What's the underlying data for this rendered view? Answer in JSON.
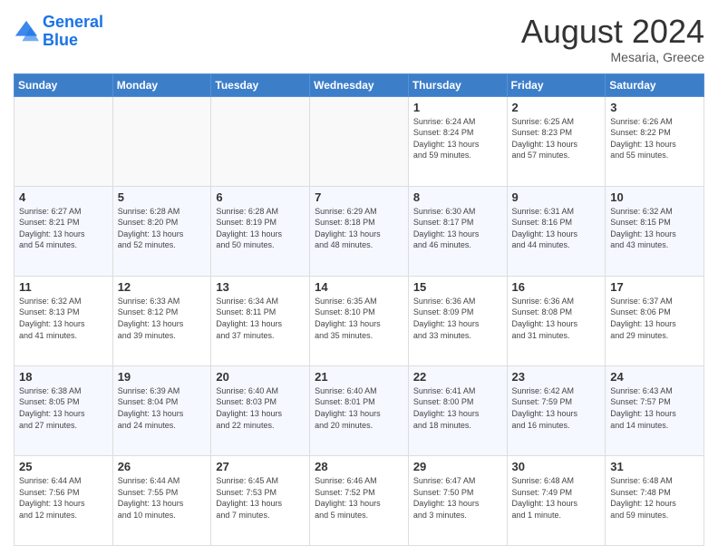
{
  "header": {
    "logo_line1": "General",
    "logo_line2": "Blue",
    "month": "August 2024",
    "location": "Mesaria, Greece"
  },
  "weekdays": [
    "Sunday",
    "Monday",
    "Tuesday",
    "Wednesday",
    "Thursday",
    "Friday",
    "Saturday"
  ],
  "weeks": [
    [
      {
        "day": "",
        "info": ""
      },
      {
        "day": "",
        "info": ""
      },
      {
        "day": "",
        "info": ""
      },
      {
        "day": "",
        "info": ""
      },
      {
        "day": "1",
        "info": "Sunrise: 6:24 AM\nSunset: 8:24 PM\nDaylight: 13 hours\nand 59 minutes."
      },
      {
        "day": "2",
        "info": "Sunrise: 6:25 AM\nSunset: 8:23 PM\nDaylight: 13 hours\nand 57 minutes."
      },
      {
        "day": "3",
        "info": "Sunrise: 6:26 AM\nSunset: 8:22 PM\nDaylight: 13 hours\nand 55 minutes."
      }
    ],
    [
      {
        "day": "4",
        "info": "Sunrise: 6:27 AM\nSunset: 8:21 PM\nDaylight: 13 hours\nand 54 minutes."
      },
      {
        "day": "5",
        "info": "Sunrise: 6:28 AM\nSunset: 8:20 PM\nDaylight: 13 hours\nand 52 minutes."
      },
      {
        "day": "6",
        "info": "Sunrise: 6:28 AM\nSunset: 8:19 PM\nDaylight: 13 hours\nand 50 minutes."
      },
      {
        "day": "7",
        "info": "Sunrise: 6:29 AM\nSunset: 8:18 PM\nDaylight: 13 hours\nand 48 minutes."
      },
      {
        "day": "8",
        "info": "Sunrise: 6:30 AM\nSunset: 8:17 PM\nDaylight: 13 hours\nand 46 minutes."
      },
      {
        "day": "9",
        "info": "Sunrise: 6:31 AM\nSunset: 8:16 PM\nDaylight: 13 hours\nand 44 minutes."
      },
      {
        "day": "10",
        "info": "Sunrise: 6:32 AM\nSunset: 8:15 PM\nDaylight: 13 hours\nand 43 minutes."
      }
    ],
    [
      {
        "day": "11",
        "info": "Sunrise: 6:32 AM\nSunset: 8:13 PM\nDaylight: 13 hours\nand 41 minutes."
      },
      {
        "day": "12",
        "info": "Sunrise: 6:33 AM\nSunset: 8:12 PM\nDaylight: 13 hours\nand 39 minutes."
      },
      {
        "day": "13",
        "info": "Sunrise: 6:34 AM\nSunset: 8:11 PM\nDaylight: 13 hours\nand 37 minutes."
      },
      {
        "day": "14",
        "info": "Sunrise: 6:35 AM\nSunset: 8:10 PM\nDaylight: 13 hours\nand 35 minutes."
      },
      {
        "day": "15",
        "info": "Sunrise: 6:36 AM\nSunset: 8:09 PM\nDaylight: 13 hours\nand 33 minutes."
      },
      {
        "day": "16",
        "info": "Sunrise: 6:36 AM\nSunset: 8:08 PM\nDaylight: 13 hours\nand 31 minutes."
      },
      {
        "day": "17",
        "info": "Sunrise: 6:37 AM\nSunset: 8:06 PM\nDaylight: 13 hours\nand 29 minutes."
      }
    ],
    [
      {
        "day": "18",
        "info": "Sunrise: 6:38 AM\nSunset: 8:05 PM\nDaylight: 13 hours\nand 27 minutes."
      },
      {
        "day": "19",
        "info": "Sunrise: 6:39 AM\nSunset: 8:04 PM\nDaylight: 13 hours\nand 24 minutes."
      },
      {
        "day": "20",
        "info": "Sunrise: 6:40 AM\nSunset: 8:03 PM\nDaylight: 13 hours\nand 22 minutes."
      },
      {
        "day": "21",
        "info": "Sunrise: 6:40 AM\nSunset: 8:01 PM\nDaylight: 13 hours\nand 20 minutes."
      },
      {
        "day": "22",
        "info": "Sunrise: 6:41 AM\nSunset: 8:00 PM\nDaylight: 13 hours\nand 18 minutes."
      },
      {
        "day": "23",
        "info": "Sunrise: 6:42 AM\nSunset: 7:59 PM\nDaylight: 13 hours\nand 16 minutes."
      },
      {
        "day": "24",
        "info": "Sunrise: 6:43 AM\nSunset: 7:57 PM\nDaylight: 13 hours\nand 14 minutes."
      }
    ],
    [
      {
        "day": "25",
        "info": "Sunrise: 6:44 AM\nSunset: 7:56 PM\nDaylight: 13 hours\nand 12 minutes."
      },
      {
        "day": "26",
        "info": "Sunrise: 6:44 AM\nSunset: 7:55 PM\nDaylight: 13 hours\nand 10 minutes."
      },
      {
        "day": "27",
        "info": "Sunrise: 6:45 AM\nSunset: 7:53 PM\nDaylight: 13 hours\nand 7 minutes."
      },
      {
        "day": "28",
        "info": "Sunrise: 6:46 AM\nSunset: 7:52 PM\nDaylight: 13 hours\nand 5 minutes."
      },
      {
        "day": "29",
        "info": "Sunrise: 6:47 AM\nSunset: 7:50 PM\nDaylight: 13 hours\nand 3 minutes."
      },
      {
        "day": "30",
        "info": "Sunrise: 6:48 AM\nSunset: 7:49 PM\nDaylight: 13 hours\nand 1 minute."
      },
      {
        "day": "31",
        "info": "Sunrise: 6:48 AM\nSunset: 7:48 PM\nDaylight: 12 hours\nand 59 minutes."
      }
    ]
  ]
}
